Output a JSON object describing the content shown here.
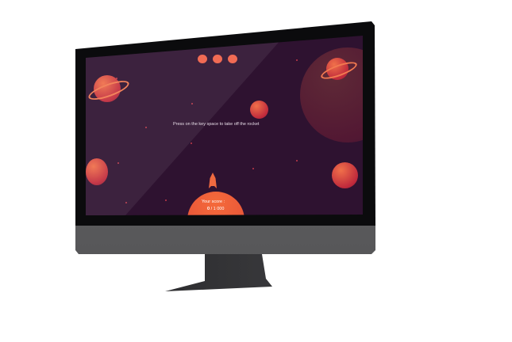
{
  "game": {
    "message": "Press on the key space to take off the rocket",
    "score_label": "Your score :",
    "score_value": "0",
    "score_max": "/ 1 000",
    "lives": 3
  },
  "colors": {
    "background": "#2e1230",
    "accent": "#f06048",
    "planet": "#c02a3c"
  }
}
